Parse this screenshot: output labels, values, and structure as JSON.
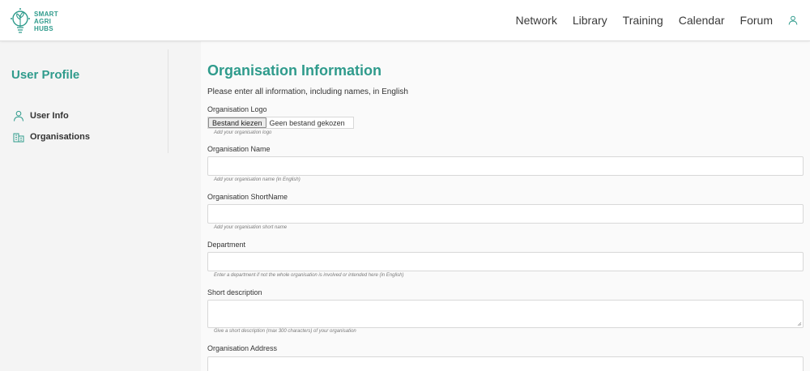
{
  "brand": {
    "name_line1": "SMART",
    "name_line2": "AGRI",
    "name_line3": "HUBS",
    "color": "#2f9b8c"
  },
  "nav": {
    "items": [
      "Network",
      "Library",
      "Training",
      "Calendar",
      "Forum"
    ],
    "user_icon": "user-icon"
  },
  "sidebar": {
    "title": "User Profile",
    "items": [
      {
        "label": "User Info",
        "icon": "user-icon"
      },
      {
        "label": "Organisations",
        "icon": "building-icon"
      }
    ]
  },
  "main": {
    "title": "Organisation Information",
    "intro": "Please enter all information, including names, in English",
    "logo": {
      "label": "Organisation Logo",
      "button": "Bestand kiezen",
      "status": "Geen bestand gekozen",
      "hint": "Add your organisation logo"
    },
    "fields": [
      {
        "label": "Organisation Name",
        "value": "",
        "hint": "Add your organisation name (in English)"
      },
      {
        "label": "Organisation ShortName",
        "value": "",
        "hint": "Add your organisation short name"
      },
      {
        "label": "Department",
        "value": "",
        "hint": "Enter a department if not the whole organisation is involved or intended here (in English)"
      },
      {
        "label": "Short description",
        "value": "",
        "hint": "Give a short description (max 300 characters) of your organisation"
      },
      {
        "label": "Organisation Address",
        "value": "",
        "hint": ""
      }
    ]
  }
}
